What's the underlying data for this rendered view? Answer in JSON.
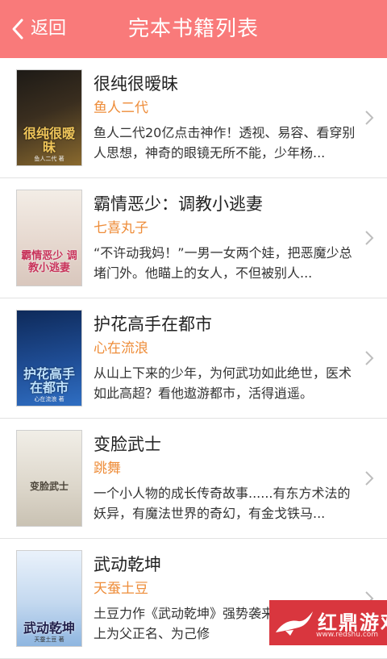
{
  "header": {
    "back_label": "返回",
    "title": "完本书籍列表"
  },
  "books": [
    {
      "title": "很纯很暧昧",
      "author": "鱼人二代",
      "description": "鱼人二代20亿点击神作！透视、易容、看穿别人思想，神奇的眼镜无所不能，少年杨...",
      "cover_text": "很纯很暧昧",
      "cover_sub": "鱼人二代 著",
      "cover_colors": [
        "#1d1a16",
        "#8a6a2e",
        "#e8c060"
      ]
    },
    {
      "title": "霸情恶少：调教小逃妻",
      "author": "七喜丸子",
      "description": "“不许动我妈！”一男一女两个娃，把恶魔少总堵门外。他瞄上的女人，不但被别人...",
      "cover_text": "霸情恶少 调教小逃妻",
      "cover_sub": "",
      "cover_colors": [
        "#f3ede6",
        "#d9c7bd",
        "#c7335a"
      ]
    },
    {
      "title": "护花高手在都市",
      "author": "心在流浪",
      "description": "从山上下来的少年，为何武功如此绝世，医术如此高超？看他遨游都市，活得逍遥。",
      "cover_text": "护花高手在都市",
      "cover_sub": "心在流浪 著",
      "cover_colors": [
        "#0e2a5a",
        "#2f6ec2",
        "#9fd0ff"
      ]
    },
    {
      "title": "变脸武士",
      "author": "跳舞",
      "description": "一个小人物的成长传奇故事......有东方术法的妖异，有魔法世界的奇幻，有金戈铁马...",
      "cover_text": "变脸武士",
      "cover_sub": "",
      "cover_colors": [
        "#f1eee7",
        "#c9c2b3",
        "#6b6355"
      ]
    },
    {
      "title": "武动乾坤",
      "author": "天蚕土豆",
      "description": "土豆力作《武动乾坤》强势袭来，林动如何踏上为父正名、为己修",
      "cover_text": "武动乾坤",
      "cover_sub": "天蚕土豆 著",
      "cover_colors": [
        "#eaf2fb",
        "#8fb6e0",
        "#2a2a5a"
      ]
    }
  ],
  "watermark": {
    "text": "红鼎游戏",
    "url": "www.redshu.com",
    "color": "#d9363e"
  },
  "colors": {
    "header_bg": "#f97a7a",
    "author": "#ee8d3a",
    "divider": "#e2e2e2"
  }
}
